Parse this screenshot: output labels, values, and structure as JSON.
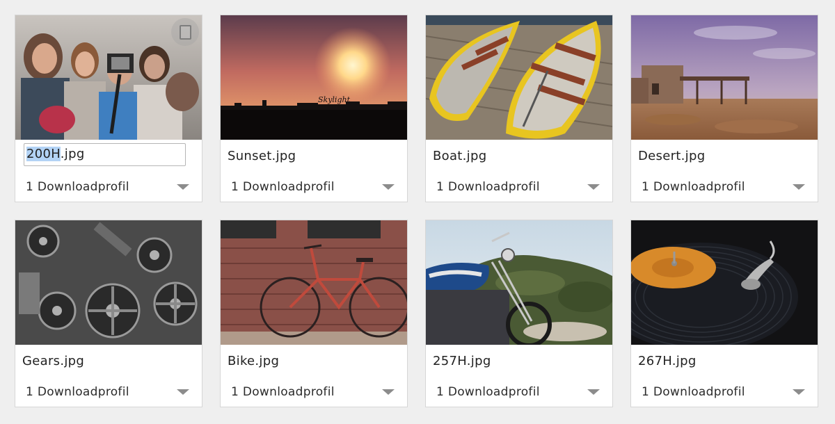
{
  "assets": [
    {
      "filename": "200H.jpg",
      "filename_selected_part": "200H",
      "filename_rest": ".jpg",
      "editing": true,
      "profile": "1 Downloadprofil",
      "image": "group selfie with action camera"
    },
    {
      "filename": "Sunset.jpg",
      "profile": "1 Downloadprofil",
      "image": "orange sunset over city skyline",
      "image_text": "Skylight"
    },
    {
      "filename": "Boat.jpg",
      "profile": "1 Downloadprofil",
      "image": "two wooden rowing boats on a dock"
    },
    {
      "filename": "Desert.jpg",
      "profile": "1 Downloadprofil",
      "image": "abandoned building in desert"
    },
    {
      "filename": "Gears.jpg",
      "profile": "1 Downloadprofil",
      "image": "black and white metal gears"
    },
    {
      "filename": "Bike.jpg",
      "profile": "1 Downloadprofil",
      "image": "red bicycle against brick wall"
    },
    {
      "filename": "257H.jpg",
      "profile": "1 Downloadprofil",
      "image": "vintage motorcycle on hillside"
    },
    {
      "filename": "267H.jpg",
      "profile": "1 Downloadprofil",
      "image": "vinyl record on turntable"
    }
  ]
}
